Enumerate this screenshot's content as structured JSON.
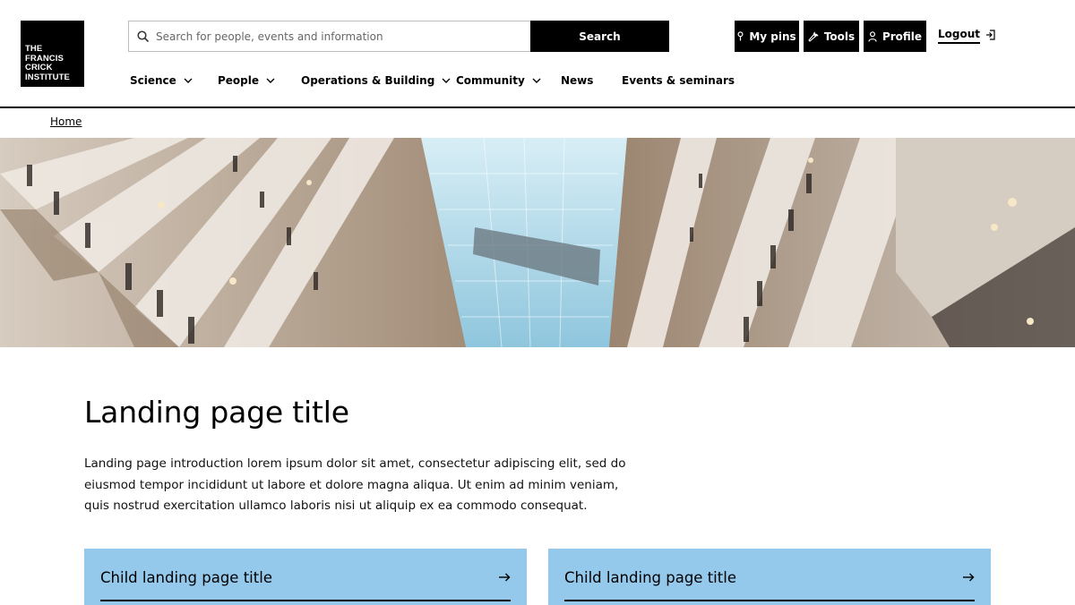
{
  "header": {
    "logo_lines": [
      "THE",
      "FRANCIS",
      "CRICK",
      "INSTITUTE"
    ],
    "search": {
      "placeholder": "Search for people, events and information",
      "button_label": "Search"
    },
    "utility": {
      "pins_label": "My pins",
      "tools_label": "Tools",
      "profile_label": "Profile",
      "logout_label": "Logout"
    }
  },
  "nav": {
    "items": [
      {
        "label": "Science",
        "has_dropdown": true
      },
      {
        "label": "People",
        "has_dropdown": true
      },
      {
        "label": "Operations & Building",
        "has_dropdown": true
      },
      {
        "label": "Community",
        "has_dropdown": true
      },
      {
        "label": "News",
        "has_dropdown": false
      },
      {
        "label": "Events & seminars",
        "has_dropdown": false
      }
    ]
  },
  "breadcrumb": {
    "home_label": "Home"
  },
  "main": {
    "title": "Landing page title",
    "intro": "Landing page introduction lorem ipsum dolor sit amet, consectetur adipiscing elit, sed do eiusmod tempor incididunt ut labore et dolore magna aliqua. Ut enim ad minim veniam, quis nostrud exercitation ullamco laboris nisi ut aliquip ex ea commodo consequat.",
    "cards": [
      {
        "title": "Child landing page title"
      },
      {
        "title": "Child landing page title"
      }
    ]
  },
  "colors": {
    "brand": "#000000",
    "card_background": "#94c9ec",
    "page_background": "#ffffff"
  },
  "icons": [
    "search-icon",
    "pin-icon",
    "wrench-icon",
    "person-icon",
    "logout-icon",
    "chevron-down-icon",
    "arrow-right-icon"
  ]
}
